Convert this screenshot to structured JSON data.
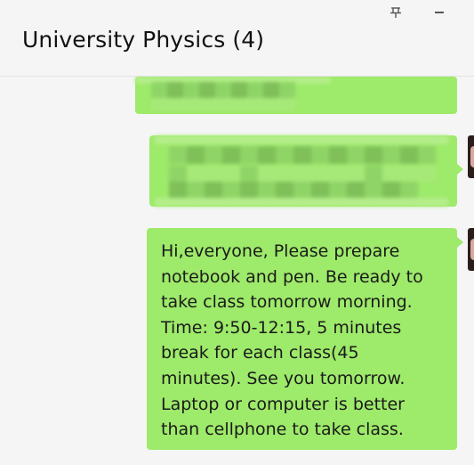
{
  "window": {
    "title": "University Physics (4)",
    "pin_icon": "pin-icon",
    "minimize_icon": "minimize-icon"
  },
  "messages": [
    {
      "type": "blurred",
      "sender": "self",
      "bubble_color": "#9eea6a"
    },
    {
      "type": "blurred",
      "sender": "self",
      "bubble_color": "#9eea6a"
    },
    {
      "type": "text",
      "sender": "self",
      "bubble_color": "#9eea6a",
      "text": "Hi,everyone, Please prepare\nnotebook and pen. Be ready to\ntake class tomorrow morning.\nTime: 9:50-12:15, 5 minutes\nbreak for each class(45\nminutes). See you tomorrow.\nLaptop or computer is better\nthan cellphone to take class."
    }
  ]
}
